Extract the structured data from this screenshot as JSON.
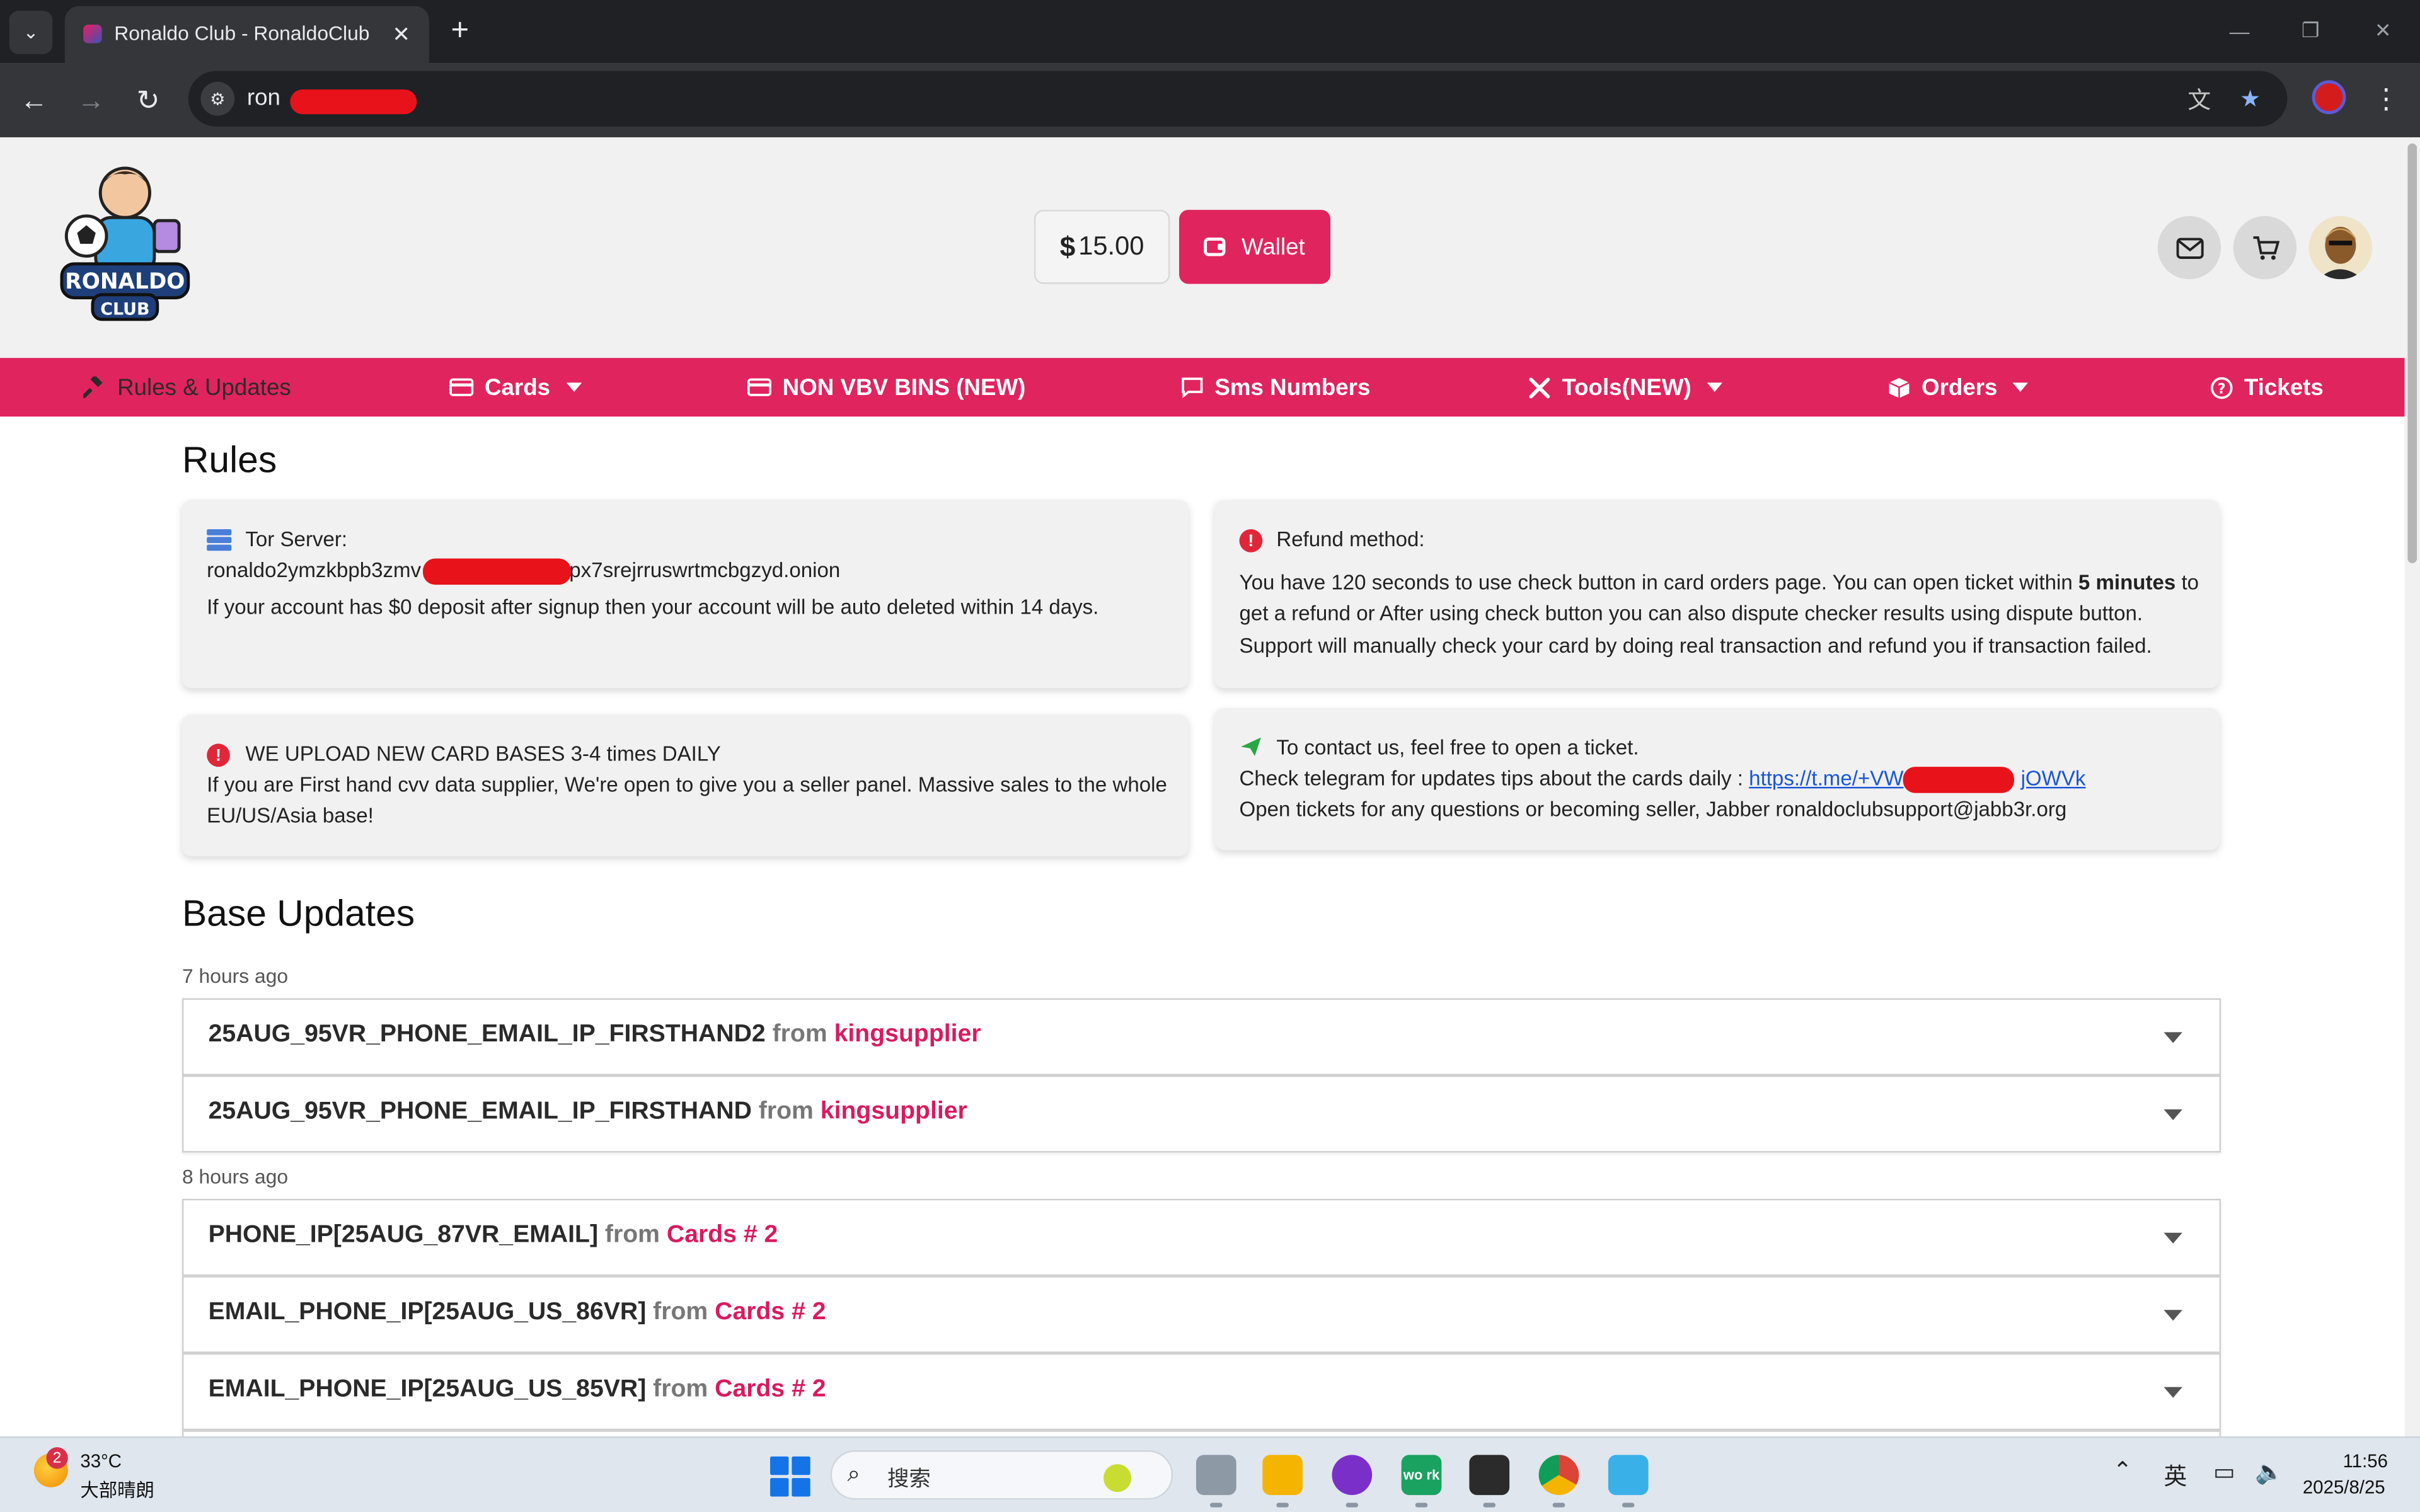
{
  "browser": {
    "tab_title": "Ronaldo Club - RonaldoClub",
    "url_visible": "ron",
    "window_controls": {
      "minimize": "—",
      "restore": "❐",
      "close": "✕"
    }
  },
  "header": {
    "balance": "15.00",
    "currency_symbol": "$",
    "wallet_label": "Wallet",
    "logo_text_top": "RONALDO",
    "logo_text_bottom": "CLUB"
  },
  "nav": {
    "items": [
      {
        "label": "Rules & Updates",
        "icon": "gavel-icon"
      },
      {
        "label": "Cards",
        "icon": "credit-card-icon"
      },
      {
        "label": "NON VBV BINS (NEW)",
        "icon": "credit-card-icon"
      },
      {
        "label": "Sms Numbers",
        "icon": "message-icon"
      },
      {
        "label": "Tools(NEW)",
        "icon": "tools-icon"
      },
      {
        "label": "Orders",
        "icon": "box-icon"
      },
      {
        "label": "Tickets",
        "icon": "question-circle-icon"
      }
    ]
  },
  "rules": {
    "heading": "Rules",
    "tor": {
      "title": "Tor Server:",
      "address_start": "ronaldo2ymzkbpb3zmv",
      "address_end": "px7srejrruswrtmcbgzyd.onion",
      "warning": "If your account has $0 deposit after signup then your account will be auto deleted within 14 days."
    },
    "refund": {
      "title": "Refund method:",
      "line1_before": "You have 120 seconds to use check button in card orders page. You can open ticket within ",
      "line1_bold": "5 minutes",
      "line1_after": " to",
      "line2": "get a refund or After using check button you can also dispute checker results using dispute button.",
      "line3": "Support will manually check your card by doing real transaction and refund you if transaction failed."
    },
    "upload": {
      "title": "WE UPLOAD NEW CARD BASES 3-4 times DAILY",
      "line1": "If you are First hand cvv data supplier, We're open to give you a seller panel. Massive sales to the whole",
      "line2": "EU/US/Asia base!"
    },
    "contact": {
      "title": "To contact us, feel free to open a ticket.",
      "telegram_prefix": "Check telegram for updates tips about the cards daily : ",
      "telegram_link_start": "https://t.me/+VW",
      "telegram_link_end": "jOWVk",
      "jabber": "Open tickets for any questions or becoming seller, Jabber ronaldoclubsupport@jabb3r.org"
    }
  },
  "base_updates": {
    "heading": "Base Updates",
    "groups": [
      {
        "time": "7 hours ago",
        "items": [
          {
            "name": "25AUG_95VR_PHONE_EMAIL_IP_FIRSTHAND2",
            "from": "from",
            "seller": "kingsupplier"
          },
          {
            "name": "25AUG_95VR_PHONE_EMAIL_IP_FIRSTHAND",
            "from": "from",
            "seller": "kingsupplier"
          }
        ]
      },
      {
        "time": "8 hours ago",
        "items": [
          {
            "name": "PHONE_IP[25AUG_87VR_EMAIL]",
            "from": "from",
            "seller": "Cards # 2"
          },
          {
            "name": "EMAIL_PHONE_IP[25AUG_US_86VR]",
            "from": "from",
            "seller": "Cards # 2"
          },
          {
            "name": "EMAIL_PHONE_IP[25AUG_US_85VR]",
            "from": "from",
            "seller": "Cards # 2"
          }
        ]
      }
    ]
  },
  "taskbar": {
    "weather_badge": "2",
    "temperature": "33°C",
    "weather_desc": "大部晴朗",
    "search_placeholder": "搜索",
    "work_app_label": "wo rk",
    "ime": "英",
    "time": "11:56",
    "date": "2025/8/25"
  }
}
